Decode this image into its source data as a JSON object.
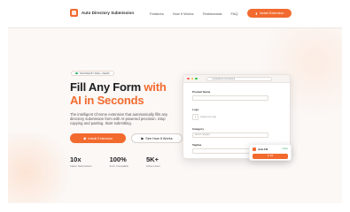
{
  "header": {
    "logo_text": "Auto Directory Submission",
    "nav": [
      "Features",
      "How It Works",
      "Testimonials",
      "FAQ"
    ],
    "cta_label": "Install Extension"
  },
  "hero": {
    "badge": "TRUSTED BY 5000+ USERS",
    "title_line1": "Fill Any Form ",
    "title_accent": "with",
    "title_line2": "AI in Seconds",
    "description": "The intelligent Chrome extension that automatically fills any directory submission form with AI-powered precision. Stop copying and pasting. Start submitting.",
    "primary_button": "Install Extension",
    "secondary_button": "See How It Works",
    "stats": [
      {
        "value": "10x",
        "label": "Faster Submissions"
      },
      {
        "value": "100%",
        "label": "Form Compatible"
      },
      {
        "value": "5K+",
        "label": "Active Users"
      }
    ]
  },
  "mockup": {
    "url": "producthunt.com/submit",
    "fields": [
      {
        "label": "Product Name",
        "value": ""
      },
      {
        "label": "Logo",
        "value": "Upload your logo"
      },
      {
        "label": "Category",
        "value": "Select category"
      },
      {
        "label": "Tagline",
        "value": ""
      }
    ],
    "popup": {
      "title": "Auto Fill",
      "status": "Active",
      "button": "AI Fill"
    }
  },
  "colors": {
    "accent": "#f26a2e",
    "success": "#2fb26a"
  }
}
